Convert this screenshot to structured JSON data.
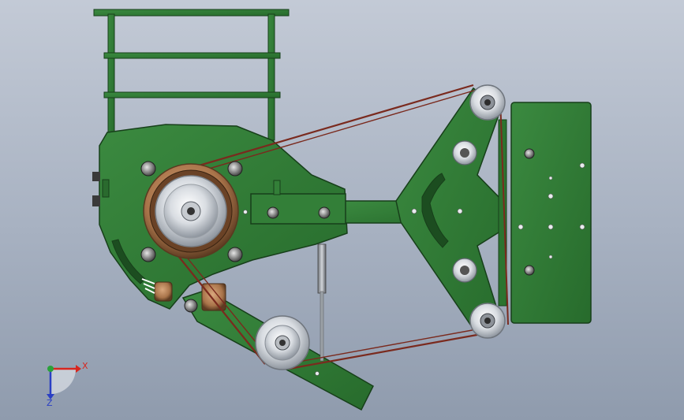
{
  "colors": {
    "background_top": "#c3cad6",
    "background_bottom": "#8f9bad",
    "frame_green": "#2f7a34",
    "frame_green_dark": "#1f5a23",
    "frame_edge": "#173f1a",
    "belt": "#7a2a1e",
    "pulley_silver": "#d9dde2",
    "bronze": "#a9744a",
    "x_axis": "#d8261e",
    "y_axis": "#2aa23a",
    "z_axis": "#2a3fc4"
  },
  "triad": {
    "x_label": "X",
    "z_label": "Z"
  }
}
